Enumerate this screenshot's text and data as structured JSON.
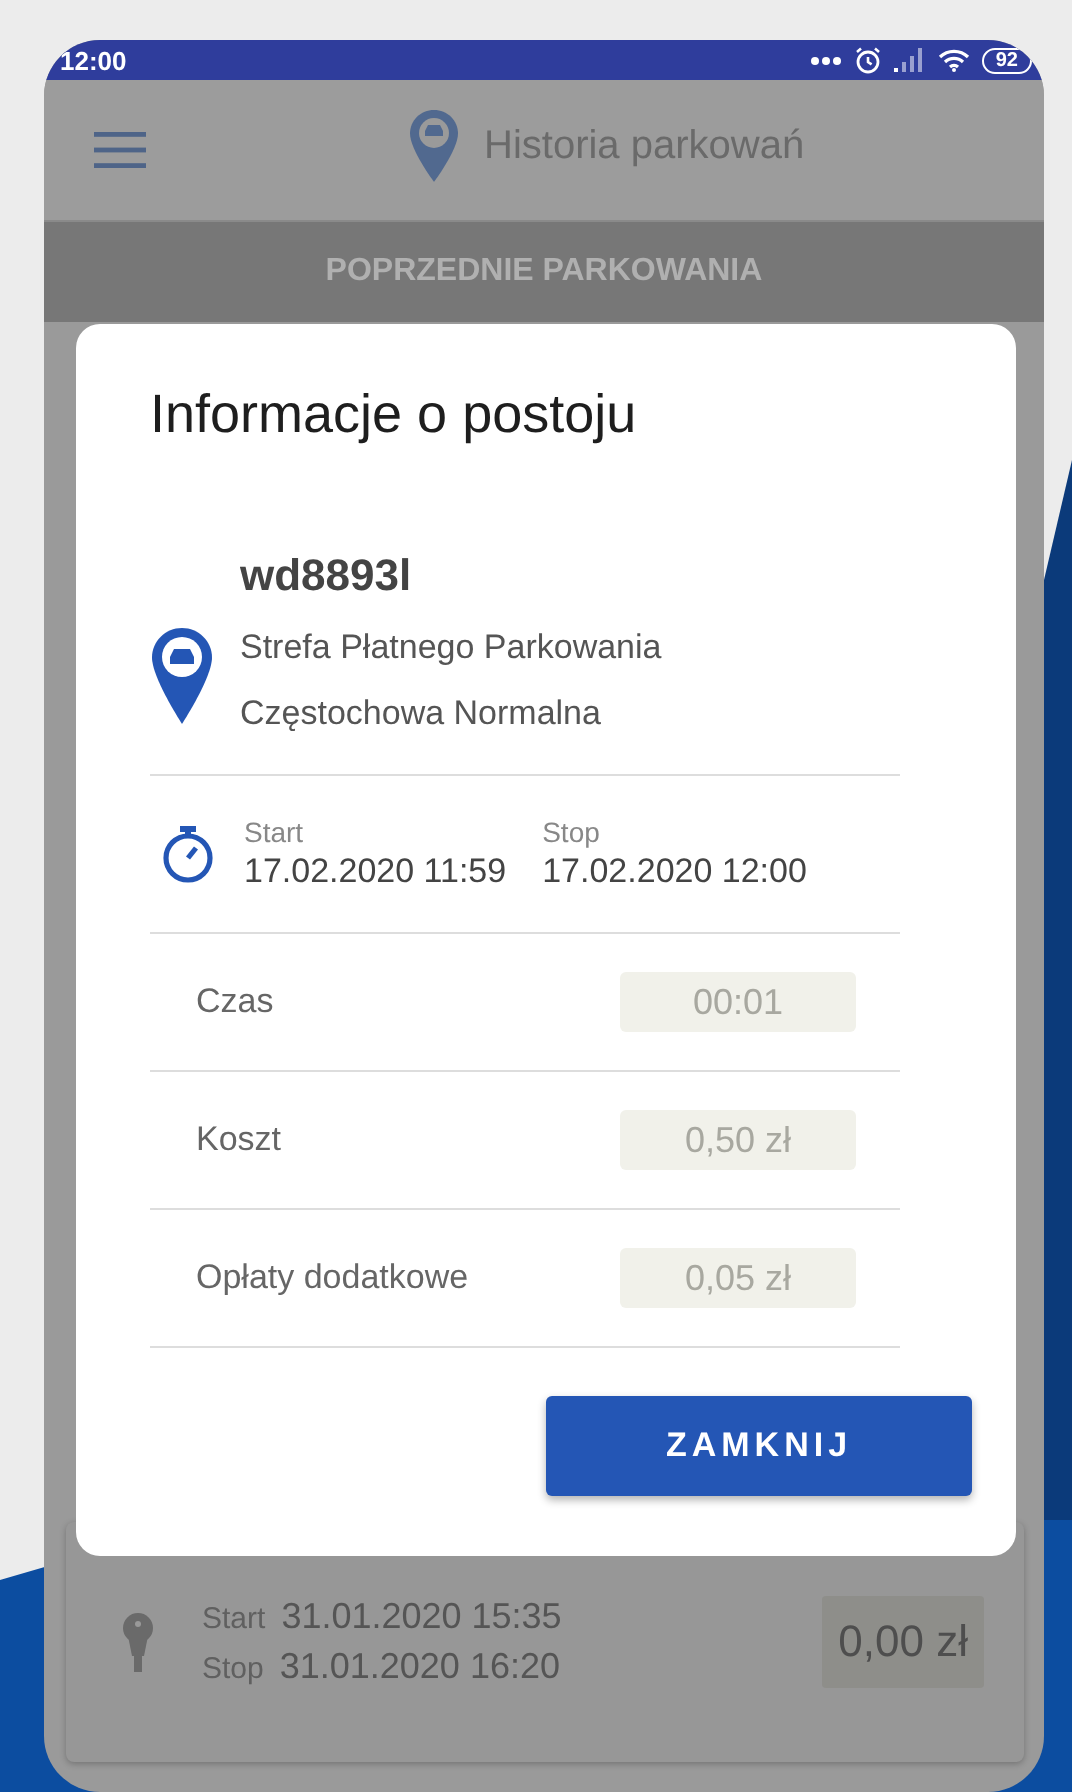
{
  "status_bar": {
    "time": "12:00",
    "battery": "92"
  },
  "app_bar": {
    "title": "Historia parkowań"
  },
  "section_header": "POPRZEDNIE PARKOWANIA",
  "history": [
    {
      "start_label": "Start",
      "start": "31.01.2020 15:35",
      "stop_label": "Stop",
      "stop": "31.01.2020 16:20",
      "amount": "0,00 zł"
    }
  ],
  "dialog": {
    "title": "Informacje o postoju",
    "plate": "wd8893l",
    "zone": [
      "Strefa Płatnego Parkowania",
      "Częstochowa Normalna"
    ],
    "start_label": "Start",
    "start": "17.02.2020 11:59",
    "stop_label": "Stop",
    "stop": "17.02.2020 12:00",
    "rows": [
      {
        "label": "Czas",
        "value": "00:01"
      },
      {
        "label": "Koszt",
        "value": "0,50 zł"
      },
      {
        "label": "Opłaty dodatkowe",
        "value": "0,05 zł"
      }
    ],
    "button": "ZAMKNIJ"
  }
}
